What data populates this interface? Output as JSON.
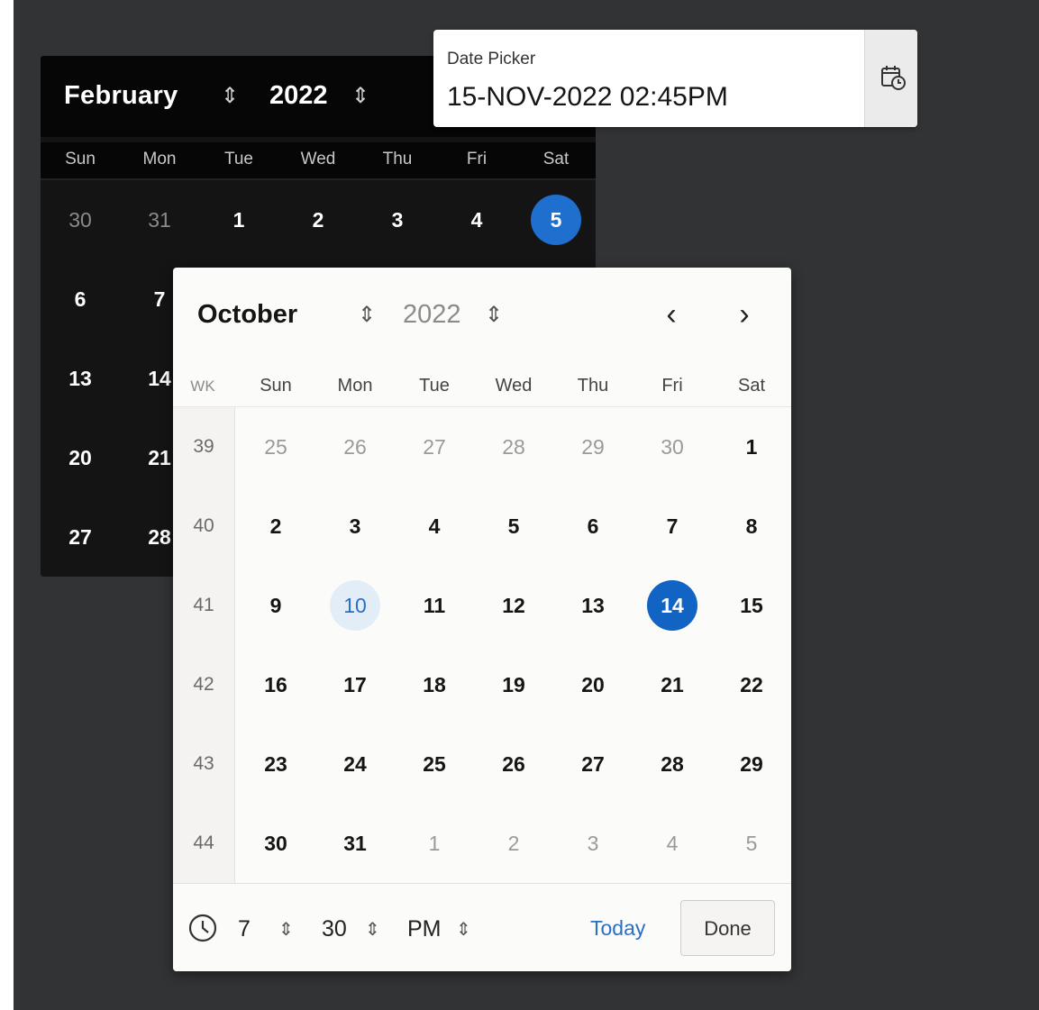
{
  "colors": {
    "backdrop": "#323335",
    "accent": "#1163c4",
    "dark_calendar_bg": "#141414",
    "light_calendar_bg": "#fbfbfa"
  },
  "dark_calendar": {
    "month": "February",
    "year": "2022",
    "spinner_icon": "up-down-chevron-icon",
    "weekdays": [
      "Sun",
      "Mon",
      "Tue",
      "Wed",
      "Thu",
      "Fri",
      "Sat"
    ],
    "weeks": [
      [
        {
          "d": "30",
          "m": true
        },
        {
          "d": "31",
          "m": true
        },
        {
          "d": "1"
        },
        {
          "d": "2"
        },
        {
          "d": "3"
        },
        {
          "d": "4"
        },
        {
          "d": "5",
          "s": true
        }
      ],
      [
        {
          "d": "6"
        },
        {
          "d": "7"
        }
      ],
      [
        {
          "d": "13"
        },
        {
          "d": "14"
        }
      ],
      [
        {
          "d": "20"
        },
        {
          "d": "21"
        }
      ],
      [
        {
          "d": "27"
        },
        {
          "d": "28"
        }
      ]
    ]
  },
  "date_field": {
    "label": "Date Picker",
    "value": "15-NOV-2022 02:45PM",
    "button_icon": "calendar-clock-icon"
  },
  "light_calendar": {
    "month": "October",
    "year": "2022",
    "prev_icon": "chevron-left-icon",
    "next_icon": "chevron-right-icon",
    "week_label": "WK",
    "weekdays": [
      "Sun",
      "Mon",
      "Tue",
      "Wed",
      "Thu",
      "Fri",
      "Sat"
    ],
    "weeks": [
      {
        "wk": "39",
        "days": [
          {
            "d": "25",
            "m": true
          },
          {
            "d": "26",
            "m": true
          },
          {
            "d": "27",
            "m": true
          },
          {
            "d": "28",
            "m": true
          },
          {
            "d": "29",
            "m": true
          },
          {
            "d": "30",
            "m": true
          },
          {
            "d": "1"
          }
        ]
      },
      {
        "wk": "40",
        "days": [
          {
            "d": "2"
          },
          {
            "d": "3"
          },
          {
            "d": "4"
          },
          {
            "d": "5"
          },
          {
            "d": "6"
          },
          {
            "d": "7"
          },
          {
            "d": "8"
          }
        ]
      },
      {
        "wk": "41",
        "days": [
          {
            "d": "9"
          },
          {
            "d": "10",
            "t": true
          },
          {
            "d": "11"
          },
          {
            "d": "12"
          },
          {
            "d": "13"
          },
          {
            "d": "14",
            "s": true
          },
          {
            "d": "15"
          }
        ]
      },
      {
        "wk": "42",
        "days": [
          {
            "d": "16"
          },
          {
            "d": "17"
          },
          {
            "d": "18"
          },
          {
            "d": "19"
          },
          {
            "d": "20"
          },
          {
            "d": "21"
          },
          {
            "d": "22"
          }
        ]
      },
      {
        "wk": "43",
        "days": [
          {
            "d": "23"
          },
          {
            "d": "24"
          },
          {
            "d": "25"
          },
          {
            "d": "26"
          },
          {
            "d": "27"
          },
          {
            "d": "28"
          },
          {
            "d": "29"
          }
        ]
      },
      {
        "wk": "44",
        "days": [
          {
            "d": "30"
          },
          {
            "d": "31"
          },
          {
            "d": "1",
            "m": true
          },
          {
            "d": "2",
            "m": true
          },
          {
            "d": "3",
            "m": true
          },
          {
            "d": "4",
            "m": true
          },
          {
            "d": "5",
            "m": true
          }
        ]
      }
    ],
    "time": {
      "hour": "7",
      "minute": "30",
      "meridiem": "PM",
      "clock_icon": "clock-icon"
    },
    "today_label": "Today",
    "done_label": "Done"
  }
}
